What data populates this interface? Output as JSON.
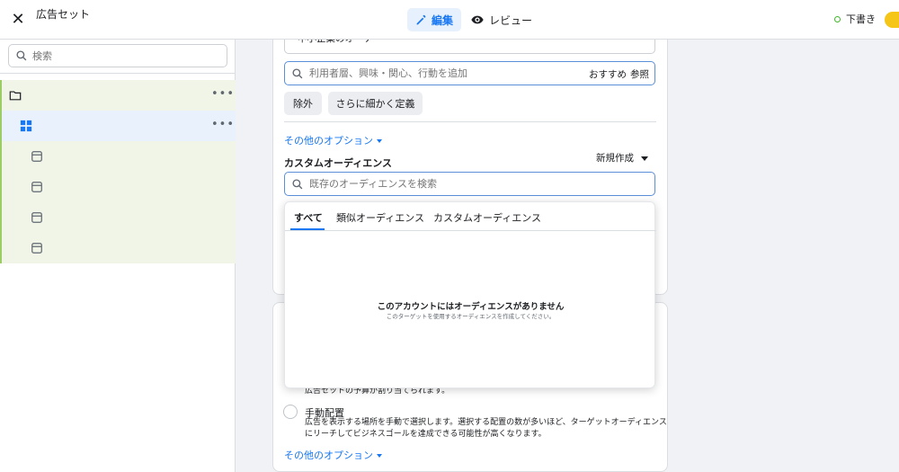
{
  "header": {
    "title": "広告セット",
    "tab_edit": "編集",
    "tab_review": "レビュー",
    "status": "下書き"
  },
  "sidebar": {
    "search_placeholder": "検索"
  },
  "audience": {
    "top_field_text": "中小企業のオーナー",
    "detail_search_placeholder": "利用者層、興味・関心、行動を追加",
    "suggest": "おすすめ",
    "browse": "参照",
    "exclude_button": "除外",
    "narrow_button": "さらに細かく定義",
    "more_options": "その他のオプション",
    "custom_audience_title": "カスタムオーディエンス",
    "create_new": "新規作成",
    "custom_search_placeholder": "既存のオーディエンスを検索"
  },
  "dropdown": {
    "tabs": [
      "すべて",
      "類似オーディエンス",
      "カスタムオーディエンス"
    ],
    "empty_title": "このアカウントにはオーディエンスがありません",
    "empty_sub": "このターゲットを使用するオーディエンスを作成してください。"
  },
  "placement": {
    "budget_text": "広告セットの予算が割り当てられます。",
    "manual_title": "手動配置",
    "manual_desc_1": "広告を表示する場所を手動で選択します。選択する配置の数が多いほど、ターゲットオーディエンス",
    "manual_desc_2": "にリーチしてビジネスゴールを達成できる可能性が高くなります。",
    "more_options": "その他のオプション"
  },
  "colors": {
    "accent": "#1877f2",
    "tree_bg": "#f0f5e8",
    "tree_selected": "#e9f1fc"
  }
}
